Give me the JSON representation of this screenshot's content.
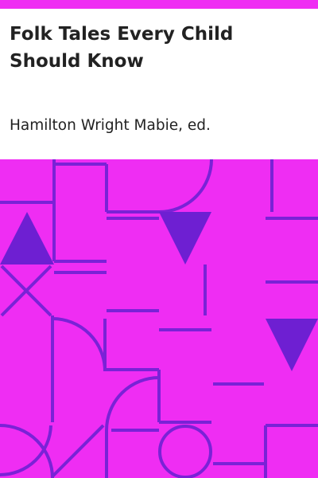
{
  "colors": {
    "accent": "#ef2df3",
    "pattern_stroke": "#7a22d6",
    "pattern_fill": "#6e1fd2",
    "text": "#222222",
    "background": "#ffffff"
  },
  "cover": {
    "title": "Folk Tales Every Child Should Know",
    "author": "Hamilton Wright Mabie, ed."
  }
}
